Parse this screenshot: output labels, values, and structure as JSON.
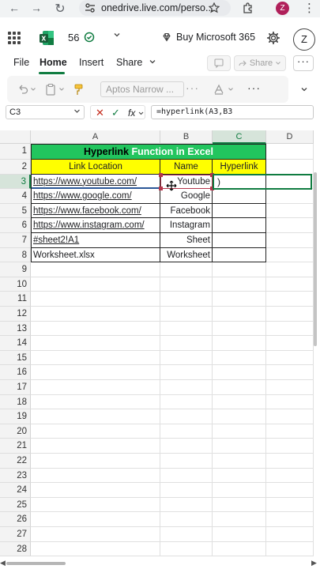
{
  "browser": {
    "back": "←",
    "forward": "→",
    "reload": "↻",
    "url": "onedrive.live.com/perso...",
    "profile_initial": "Z",
    "menu": "⋮"
  },
  "app": {
    "doc_number": "56",
    "buy_label": "Buy Microsoft 365",
    "user_initial": "Z"
  },
  "ribbon": {
    "tabs": [
      "File",
      "Home",
      "Insert",
      "Share"
    ],
    "share_label": "Share",
    "more": "···"
  },
  "toolbar": {
    "font_name": "Aptos Narrow ...",
    "more": "···"
  },
  "formula_bar": {
    "name_box": "C3",
    "cancel": "✕",
    "enter": "✓",
    "fx": "fx",
    "formula": "=hyperlink(A3,B3"
  },
  "grid": {
    "columns": [
      "A",
      "B",
      "C",
      "D"
    ],
    "rows": [
      "1",
      "2",
      "3",
      "4",
      "5",
      "6",
      "7",
      "8",
      "9",
      "10",
      "11",
      "12",
      "13",
      "14",
      "15",
      "16",
      "17",
      "18",
      "19",
      "20",
      "21",
      "22",
      "23",
      "24",
      "25",
      "26",
      "27",
      "28"
    ],
    "title_part1": "Hyperlink",
    "title_part2": " Function in Excel",
    "headers": [
      "Link Location",
      "Name",
      "Hyperlink"
    ],
    "data": [
      [
        "https://www.youtube.com/",
        "Youtube"
      ],
      [
        "https://www.google.com/",
        "Google"
      ],
      [
        "https://www.facebook.com/",
        "Facebook"
      ],
      [
        "https://www.instagram.com/",
        "Instagram"
      ],
      [
        "#sheet2!A1",
        "Sheet"
      ],
      [
        "Worksheet.xlsx",
        "Worksheet"
      ]
    ],
    "c3_edit": ")"
  },
  "colors": {
    "accent": "#107c41",
    "title_fill": "#22c55e",
    "header_fill": "#ffff00",
    "ref_b3": "#b5364c",
    "ref_a3": "#2b5797"
  }
}
